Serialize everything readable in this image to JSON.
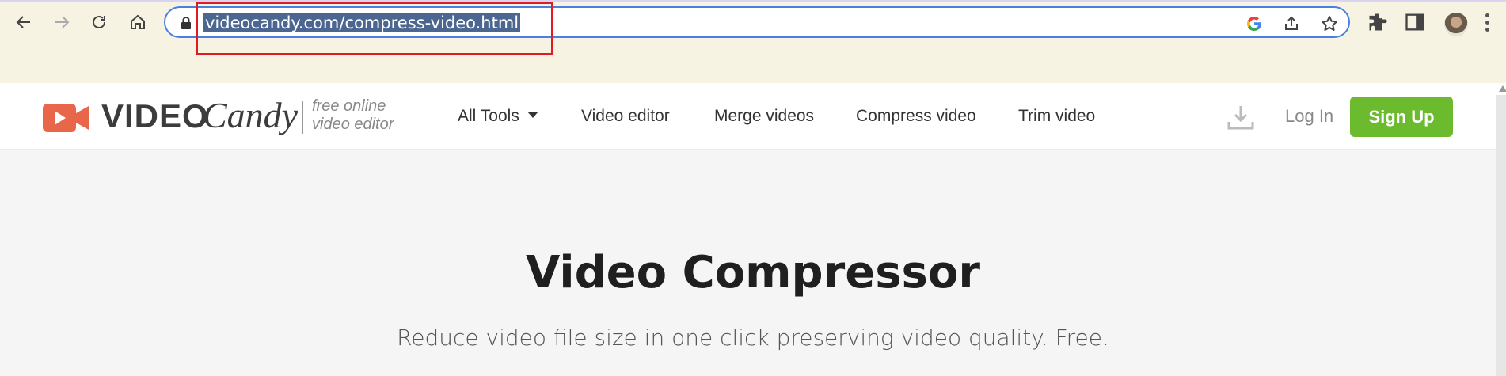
{
  "browser": {
    "url": "videocandy.com/compress-video.html",
    "icons": [
      "back-icon",
      "forward-icon",
      "reload-icon",
      "home-icon",
      "lock-icon",
      "google-icon",
      "share-icon",
      "star-icon",
      "extensions-icon",
      "side-panel-icon",
      "profile-avatar",
      "menu-icon"
    ]
  },
  "site": {
    "logo_video": "VIDEO",
    "logo_candy": "Candy",
    "tagline_line1": "free online",
    "tagline_line2": "video editor",
    "nav": {
      "all_tools": "All Tools",
      "video_editor": "Video editor",
      "merge_videos": "Merge videos",
      "compress_video": "Compress video",
      "trim_video": "Trim video"
    },
    "login": "Log In",
    "signup": "Sign Up",
    "colors": {
      "brand_orange": "#e8674a",
      "signup_green": "#6cba2d",
      "highlight": "#e01b24"
    }
  },
  "main": {
    "title": "Video Compressor",
    "subtitle": "Reduce video file size in one click preserving video quality. Free."
  }
}
